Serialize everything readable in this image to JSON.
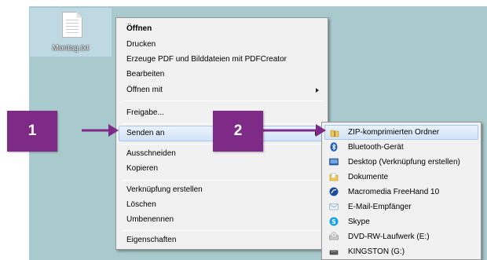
{
  "desktop_file": {
    "name": "Montag.txt"
  },
  "context_menu": {
    "items": [
      {
        "label": "Öffnen",
        "bold": true
      },
      {
        "label": "Drucken"
      },
      {
        "label": "Erzeuge PDF und Bilddateien mit PDFCreator"
      },
      {
        "label": "Bearbeiten"
      },
      {
        "label": "Öffnen mit",
        "submenu": true
      },
      {
        "label": "Freigabe..."
      },
      {
        "label": "Senden an",
        "highlighted": true
      },
      {
        "label": "Ausschneiden"
      },
      {
        "label": "Kopieren"
      },
      {
        "label": "Verknüpfung erstellen"
      },
      {
        "label": "Löschen"
      },
      {
        "label": "Umbenennen"
      },
      {
        "label": "Eigenschaften"
      }
    ]
  },
  "send_to_submenu": {
    "items": [
      {
        "label": "ZIP-komprimierten Ordner",
        "icon": "zip-folder-icon",
        "highlighted": true
      },
      {
        "label": "Bluetooth-Gerät",
        "icon": "bluetooth-icon"
      },
      {
        "label": "Desktop (Verknüpfung erstellen)",
        "icon": "desktop-icon"
      },
      {
        "label": "Dokumente",
        "icon": "documents-folder-icon"
      },
      {
        "label": "Macromedia FreeHand 10",
        "icon": "freehand-icon"
      },
      {
        "label": "E-Mail-Empfänger",
        "icon": "mail-icon"
      },
      {
        "label": "Skype",
        "icon": "skype-icon"
      },
      {
        "label": "DVD-RW-Laufwerk (E:)",
        "icon": "dvd-drive-icon"
      },
      {
        "label": "KINGSTON (G:)",
        "icon": "usb-drive-icon"
      }
    ]
  },
  "callouts": [
    {
      "number": "1"
    },
    {
      "number": "2"
    }
  ],
  "colors": {
    "callout": "#7e2a87",
    "desktop": "#a9cacc",
    "menu_bg": "#f1f1f1",
    "highlight": "#d2e4f7"
  }
}
